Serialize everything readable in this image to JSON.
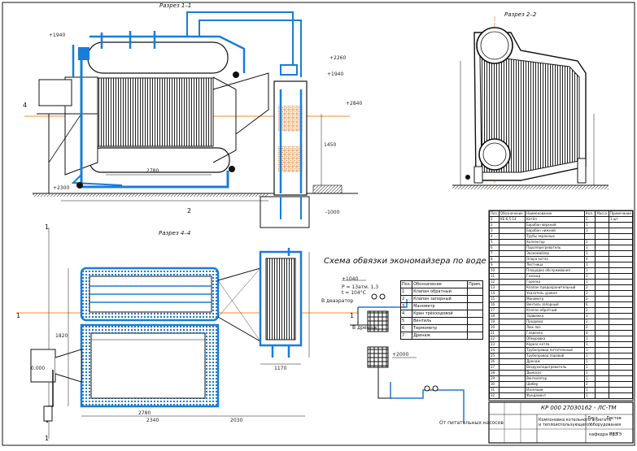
{
  "drawing": {
    "view_top_label": "Разрез 1–1",
    "view_side_label": "Разрез 2–2",
    "view_plan_label": "Разрез 4–4",
    "scheme_title": "Схема обвязки экономайзера по воде",
    "section_marks": [
      "1",
      "1",
      "1",
      "1",
      "4",
      "2"
    ],
    "elevations": [
      "+2260",
      "+2840",
      "+1940",
      "+1940",
      "-1000",
      "+2300",
      "0.000"
    ],
    "dimensions": {
      "plan_length": "2780",
      "plan_width": "1820",
      "plan_total": "2340",
      "plan_right": "2030",
      "plan_econ": "1170",
      "top_inner": "2780",
      "econ_height": "1450"
    },
    "scheme_labels": {
      "to_deaerator": "В деаэратор",
      "from_pump": "От питательных насосов",
      "drain": "В дренаж",
      "p1": "P = 13атм. 1,3",
      "p2": "t = 104°C",
      "elev1": "+1040",
      "elev2": "+2000"
    }
  },
  "legend": {
    "headers": [
      "Поз.",
      "Обозначение",
      "Прим."
    ],
    "rows": [
      {
        "pos": "1",
        "name": "Клапан обратный"
      },
      {
        "pos": "2",
        "name": "Клапан запорный"
      },
      {
        "pos": "3",
        "name": "Манометр"
      },
      {
        "pos": "4",
        "name": "Кран трёхходовой"
      },
      {
        "pos": "5",
        "name": "Вентиль"
      },
      {
        "pos": "6",
        "name": "Термометр"
      },
      {
        "pos": "7",
        "name": "Дренаж"
      }
    ]
  },
  "spec": {
    "headers": [
      "Поз.",
      "Обозначение",
      "Наименование",
      "Кол.",
      "Масса",
      "Примечание"
    ],
    "rows": [
      [
        "1",
        "КЕ-6,5-14",
        "Котёл",
        "1",
        "",
        "1 шт"
      ],
      [
        "2",
        "",
        "Барабан верхний",
        "1",
        "",
        ""
      ],
      [
        "3",
        "",
        "Барабан нижний",
        "1",
        "",
        ""
      ],
      [
        "4",
        "",
        "Трубы экранные",
        "",
        "",
        ""
      ],
      [
        "5",
        "",
        "Коллектор",
        "2",
        "",
        ""
      ],
      [
        "6",
        "",
        "Пароперегреватель",
        "1",
        "",
        ""
      ],
      [
        "7",
        "",
        "Экономайзер",
        "1",
        "",
        ""
      ],
      [
        "8",
        "",
        "Опора котла",
        "4",
        "",
        ""
      ],
      [
        "9",
        "",
        "Лестница",
        "1",
        "",
        ""
      ],
      [
        "10",
        "",
        "Площадка обслуживания",
        "1",
        "",
        ""
      ],
      [
        "11",
        "",
        "Газоход",
        "1",
        "",
        ""
      ],
      [
        "12",
        "",
        "Горелка",
        "1",
        "",
        ""
      ],
      [
        "13",
        "",
        "Клапан предохранительный",
        "2",
        "",
        ""
      ],
      [
        "14",
        "",
        "Указатель уровня",
        "2",
        "",
        ""
      ],
      [
        "15",
        "",
        "Манометр",
        "2",
        "",
        ""
      ],
      [
        "16",
        "",
        "Вентиль запорный",
        "6",
        "",
        ""
      ],
      [
        "17",
        "",
        "Клапан обратный",
        "2",
        "",
        ""
      ],
      [
        "18",
        "",
        "Задвижка",
        "3",
        "",
        ""
      ],
      [
        "19",
        "",
        "Продувка",
        "2",
        "",
        ""
      ],
      [
        "20",
        "",
        "Люк-лаз",
        "2",
        "",
        ""
      ],
      [
        "21",
        "",
        "Гляделка",
        "4",
        "",
        ""
      ],
      [
        "22",
        "",
        "Обмуровка",
        "1",
        "",
        ""
      ],
      [
        "23",
        "",
        "Каркас котла",
        "1",
        "",
        ""
      ],
      [
        "24",
        "",
        "Трубопровод питательный",
        "1",
        "",
        ""
      ],
      [
        "25",
        "",
        "Трубопровод паровой",
        "1",
        "",
        ""
      ],
      [
        "26",
        "",
        "Дренаж",
        "1",
        "",
        ""
      ],
      [
        "27",
        "",
        "Воздухоподогреватель",
        "1",
        "",
        ""
      ],
      [
        "28",
        "",
        "Дымосос",
        "1",
        "",
        ""
      ],
      [
        "29",
        "",
        "Вентилятор",
        "1",
        "",
        ""
      ],
      [
        "30",
        "",
        "Шибер",
        "2",
        "",
        ""
      ],
      [
        "31",
        "",
        "Изоляция",
        "1",
        "",
        ""
      ],
      [
        "32",
        "",
        "Фундамент",
        "1",
        "",
        ""
      ]
    ]
  },
  "stamp": {
    "code": "КР 000 27030162 - ЛС-ТМ",
    "title1": "Компоновка котельного агрегата",
    "title2": "и теплоиспользующего оборудования",
    "sheet": "Лист",
    "sheets": "Листов",
    "stage": "У",
    "dept": "кафедра ПТЭ",
    "group": "гр.ТЭ"
  },
  "colors": {
    "pipe": "#1a7cd8",
    "line": "#111111",
    "axis": "#ff8c2a",
    "cell": "#e08a3a"
  }
}
